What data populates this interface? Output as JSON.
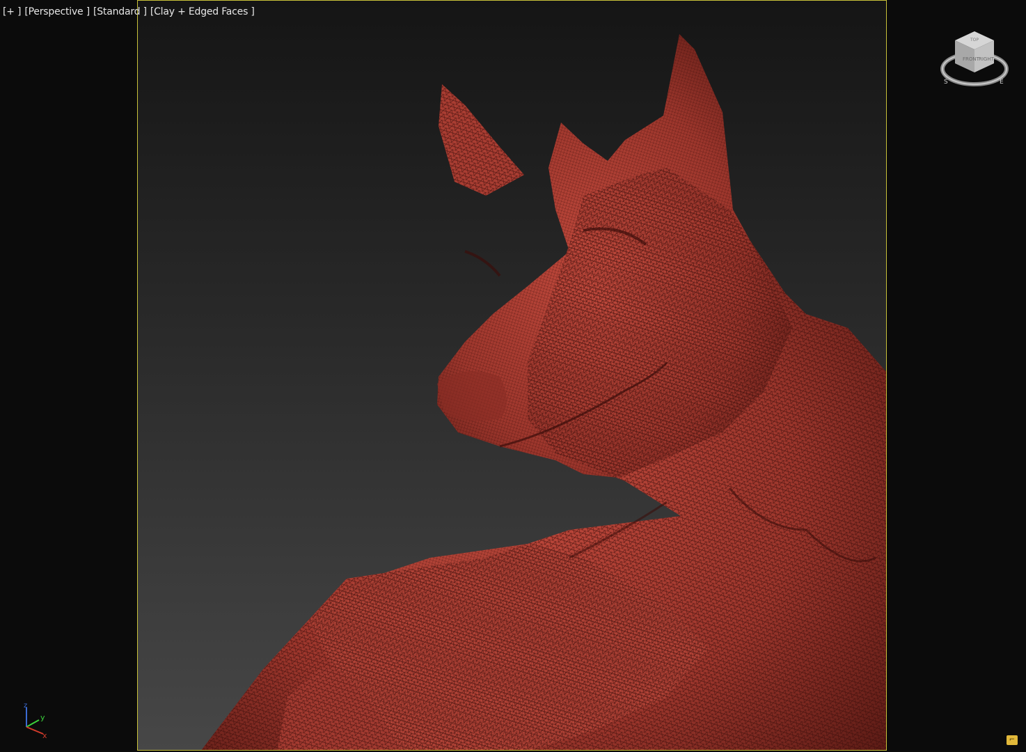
{
  "viewport": {
    "labels": [
      {
        "name": "viewport-menu-label",
        "text": "[+ ]"
      },
      {
        "name": "point-of-view-label",
        "text": "[Perspective ]"
      },
      {
        "name": "shading-preset-label",
        "text": "[Standard ]"
      },
      {
        "name": "display-mode-label",
        "text": "[Clay + Edged Faces ]"
      }
    ]
  },
  "viewcube": {
    "icon": "viewcube-icon",
    "faces": [
      "TOP",
      "FRONT",
      "RIGHT"
    ],
    "compass": [
      "S",
      "E"
    ]
  },
  "axis_tripod": {
    "icon": "axis-tripod-icon",
    "x": "x",
    "y": "y",
    "z": "z"
  },
  "corner_button": {
    "icon": "maximize-toggle-icon",
    "glyph": "⌐"
  },
  "colors": {
    "frame": "#c9c23a",
    "model": "#b8463a",
    "wire": "#3a0d0a",
    "background_top": "#151515",
    "background_bottom": "#474747",
    "x_axis": "#d23b2b",
    "y_axis": "#3bd23b",
    "z_axis": "#3b6bd2"
  }
}
